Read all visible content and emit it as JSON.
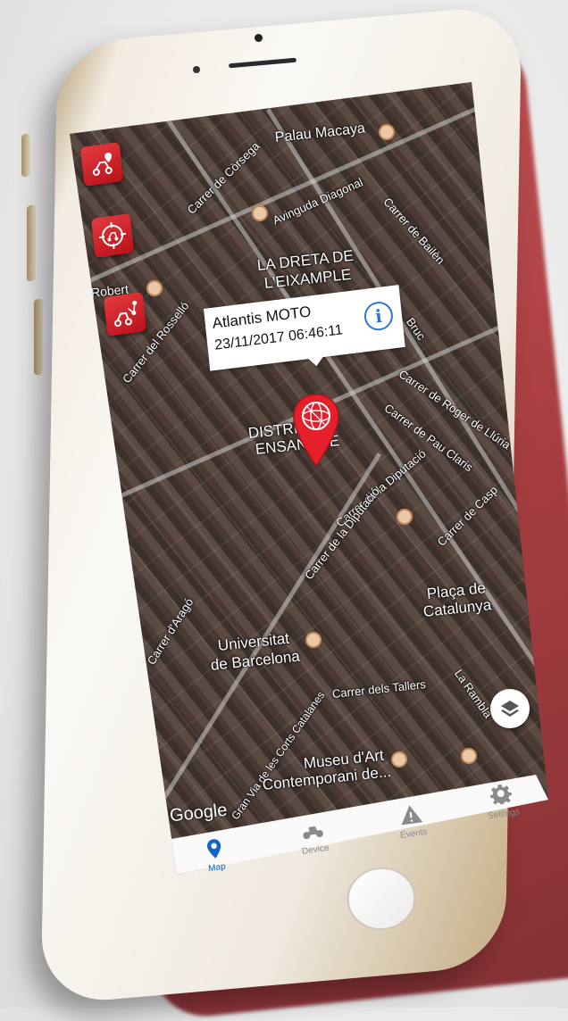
{
  "map": {
    "labels": {
      "palau_macaya": "Palau Macaya",
      "carrer_corsega": "Carrer de Còrsega",
      "avinguda_diagonal": "Avinguda Diagonal",
      "carrer_bailen": "Carrer de Bailèn",
      "dreta_line1": "LA DRETA DE",
      "dreta_line2": "L'EIXAMPLE",
      "robert": "Robert",
      "carrer_rossello": "Carrer del Rosselló",
      "bruc": "Bruc",
      "roger_lluria": "Carrer de Roger de Llúria",
      "pau_claris": "Carrer de Pau Claris",
      "distrito_line1": "DISTRITO",
      "distrito_line2": "ENSANCHE",
      "diputacio": "Carrer de la Diputació",
      "casp": "Carrer de Casp",
      "placa_line1": "Plaça de",
      "placa_line2": "Catalunya",
      "arago": "Carrer d'Aragó",
      "universitat_line1": "Universitat",
      "universitat_line2": "de Barcelona",
      "corts_catalanes": "Gran Via de les Corts Catalanes",
      "tallers": "Carrer dels Tallers",
      "rambla": "La Rambla",
      "museu_line1": "Museu d'Art",
      "museu_line2": "Contemporani de..."
    },
    "attribution": "Google"
  },
  "callout": {
    "device_name": "Atlantis MOTO",
    "timestamp": "23/11/2017 06:46:11",
    "info_glyph": "i"
  },
  "nav": {
    "items": [
      {
        "label": "Map",
        "icon": "map-pin-icon",
        "active": true
      },
      {
        "label": "Device",
        "icon": "motorcycle-icon",
        "active": false
      },
      {
        "label": "Events",
        "icon": "warning-icon",
        "active": false
      },
      {
        "label": "Settings",
        "icon": "gear-icon",
        "active": false
      }
    ]
  },
  "colors": {
    "accent_red": "#d9232a",
    "nav_active": "#1565c0",
    "info_blue": "#2e75d6"
  }
}
